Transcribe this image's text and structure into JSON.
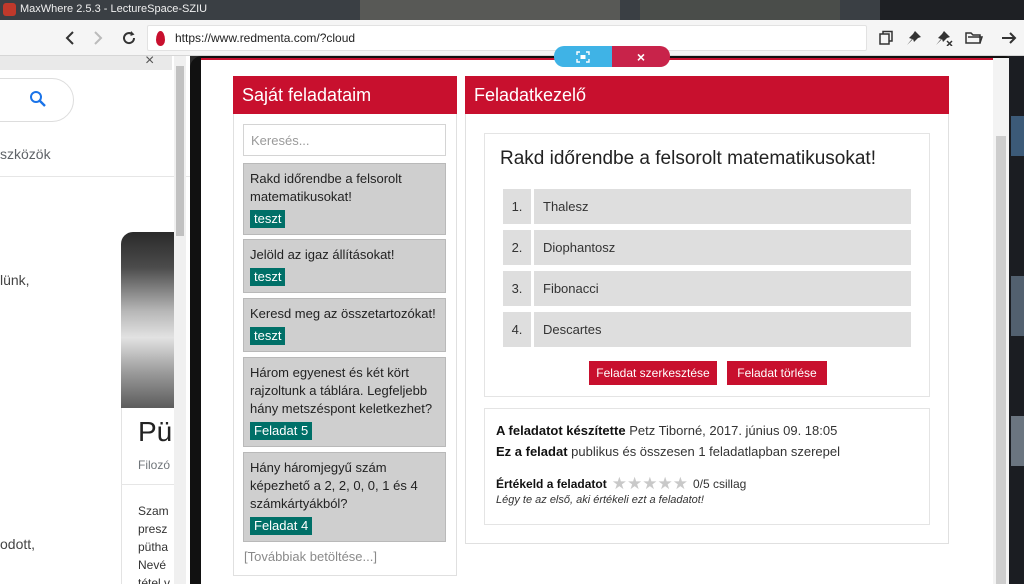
{
  "window": {
    "title": "MaxWhere 2.5.3 - LectureSpace-SZIU"
  },
  "toolbar": {
    "url": "https://www.redmenta.com/?cloud",
    "back_icon": "back-arrow-icon",
    "forward_icon": "forward-arrow-icon",
    "reload_icon": "reload-icon"
  },
  "floating_tab": {
    "pin_icon": "focus-icon",
    "close_label": "×"
  },
  "background_page": {
    "tools_label": "szközök",
    "fragment_1": "lünk,",
    "card_title": "Pü",
    "card_subtitle": "Filozó",
    "card_desc": "Szam\npresz\npütha\nNevé\ntétel v",
    "fragment_2": "odott,"
  },
  "my_tasks": {
    "header": "Saját feladataim",
    "search_placeholder": "Keresés...",
    "items": [
      {
        "title": "Rakd időrendbe a felsorolt matematikusokat!",
        "badge": "teszt"
      },
      {
        "title": "Jelöld az igaz állításokat!",
        "badge": "teszt"
      },
      {
        "title": "Keresd meg az összetartozókat!",
        "badge": "teszt"
      },
      {
        "title": "Három egyenest és két kört rajzoltunk a táblára. Legfeljebb hány metszéspont keletkezhet?",
        "badge": "Feladat 5"
      },
      {
        "title": "Hány háromjegyű szám képezhető a 2, 2, 0, 0, 1 és 4 számkártyákból?",
        "badge": "Feladat 4"
      }
    ],
    "load_more": "[Továbbiak betöltése...]"
  },
  "manager": {
    "header": "Feladatkezelő",
    "task_title": "Rakd időrendbe a felsorolt matematikusokat!",
    "order_items": [
      {
        "num": "1.",
        "name": "Thalesz"
      },
      {
        "num": "2.",
        "name": "Diophantosz"
      },
      {
        "num": "3.",
        "name": "Fibonacci"
      },
      {
        "num": "4.",
        "name": "Descartes"
      }
    ],
    "edit_button": "Feladat szerkesztése",
    "delete_button": "Feladat törlése",
    "creator_label": "A feladatot készítette",
    "creator_value": "Petz Tiborné, 2017. június 09. 18:05",
    "usage_label": "Ez a feladat",
    "usage_value": "publikus és összesen 1 feladatlapban szerepel",
    "rate_label": "Értékeld a feladatot",
    "rating": 0,
    "rating_max": 5,
    "rating_text": "0/5 csillag",
    "first_note": "Légy te az első, aki értékeli ezt a feladatot!"
  },
  "colors": {
    "accent_red": "#c8102e",
    "badge_teal": "#007068",
    "pin_blue": "#3fb3e6"
  }
}
